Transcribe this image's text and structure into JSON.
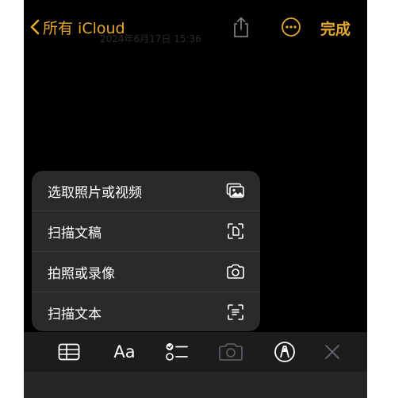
{
  "nav": {
    "back_label": "所有 iCloud",
    "date_text": "2024年6月17日 15:36",
    "done_label": "完成",
    "share_icon": "share-icon",
    "more_icon": "more-icon"
  },
  "menu": {
    "items": [
      {
        "label": "选取照片或视频",
        "icon": "photo-library-icon"
      },
      {
        "label": "扫描文稿",
        "icon": "scan-document-icon"
      },
      {
        "label": "拍照或录像",
        "icon": "camera-icon"
      },
      {
        "label": "扫描文本",
        "icon": "scan-text-icon"
      }
    ]
  },
  "toolbar": {
    "table_icon": "table-icon",
    "format_label": "Aa",
    "checklist_icon": "checklist-icon",
    "camera_icon": "camera-icon",
    "markup_icon": "markup-pen-icon",
    "close_icon": "close-icon"
  },
  "colors": {
    "accent": "#e6a92e",
    "background": "#000000",
    "menu_bg": "#2a2a2c",
    "toolbar_bg": "#1c1c1e"
  }
}
